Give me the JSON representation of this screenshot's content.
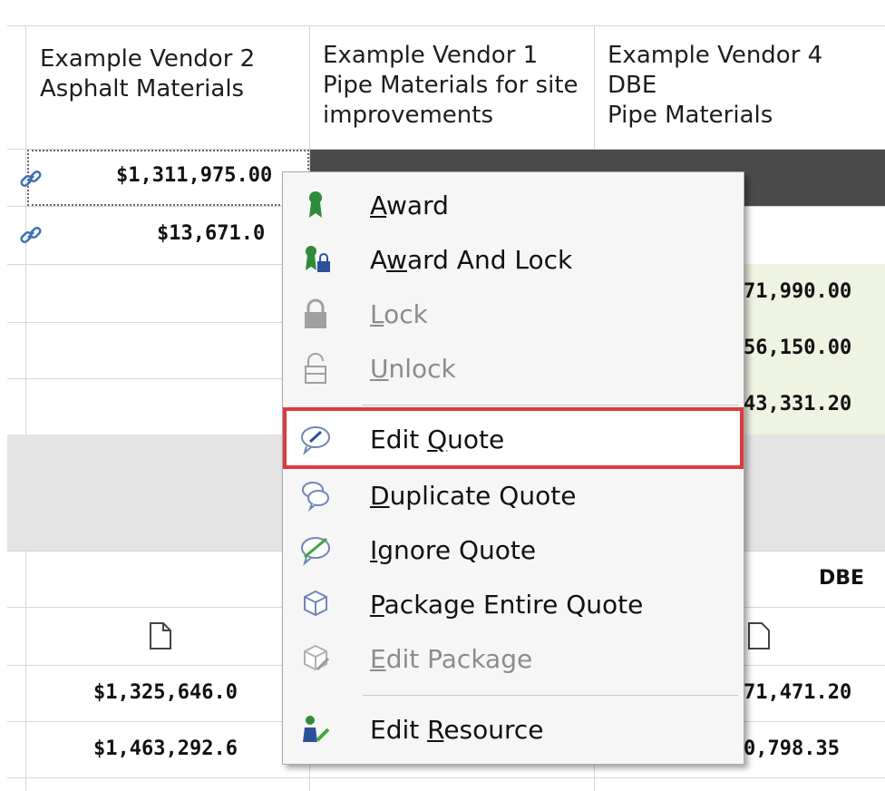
{
  "header": {
    "columns": [
      {
        "lines": [
          "Example Vendor 2",
          "Asphalt Materials"
        ]
      },
      {
        "lines": [
          "Example Vendor 1",
          "Pipe Materials for site",
          "improvements"
        ]
      },
      {
        "lines": [
          "Example Vendor 4",
          "DBE",
          "Pipe Materials"
        ]
      }
    ]
  },
  "grid": {
    "col1_values": [
      "$1,311,975.00",
      "$13,671.0"
    ],
    "col3_values": [
      "71,990.00",
      "56,150.00",
      "43,331.20"
    ],
    "dbe_label": "DBE",
    "total_col1": [
      "$1,325,646.0",
      "$1,463,292.6"
    ],
    "total_col3": [
      "71,471.20",
      "0,798.35"
    ]
  },
  "context_menu": {
    "items": [
      {
        "label": "Award",
        "mnemonic": "A",
        "icon": "award-ribbon-icon",
        "enabled": true
      },
      {
        "label": "Award And Lock",
        "mnemonic": "w",
        "icon": "award-lock-icon",
        "enabled": true
      },
      {
        "label": "Lock",
        "mnemonic": "L",
        "icon": "lock-icon",
        "enabled": false
      },
      {
        "label": "Unlock",
        "mnemonic": "U",
        "icon": "unlock-icon",
        "enabled": false
      },
      {
        "label": "Edit Quote",
        "mnemonic": "Q",
        "icon": "edit-quote-icon",
        "enabled": true,
        "highlighted": true
      },
      {
        "label": "Duplicate Quote",
        "mnemonic": "D",
        "icon": "duplicate-quote-icon",
        "enabled": true
      },
      {
        "label": "Ignore Quote",
        "mnemonic": "I",
        "icon": "ignore-quote-icon",
        "enabled": true
      },
      {
        "label": "Package Entire Quote",
        "mnemonic": "P",
        "icon": "package-icon",
        "enabled": true
      },
      {
        "label": "Edit Package",
        "mnemonic": "E",
        "icon": "edit-package-icon",
        "enabled": false
      },
      {
        "label": "Edit Resource",
        "mnemonic": "R",
        "icon": "edit-resource-icon",
        "enabled": true
      }
    ]
  },
  "colors": {
    "highlight_border": "#e0393b",
    "dark_row": "#4a4a4a",
    "green_row": "#eef3e2",
    "gray_row": "#e4e4e4",
    "link_blue": "#3d6fb5"
  }
}
